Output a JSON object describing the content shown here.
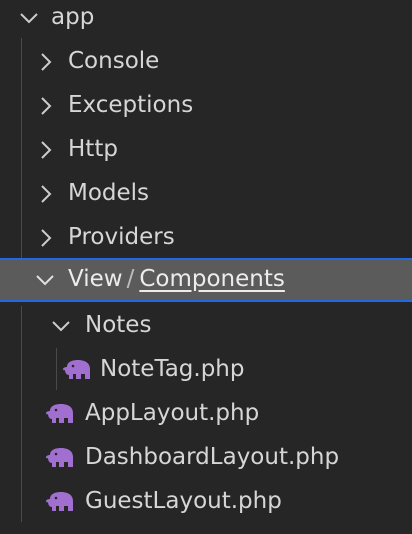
{
  "explorer": {
    "root": {
      "label": "app"
    },
    "folders": [
      {
        "label": "Console"
      },
      {
        "label": "Exceptions"
      },
      {
        "label": "Http"
      },
      {
        "label": "Models"
      },
      {
        "label": "Providers"
      }
    ],
    "selected_compact": {
      "parent": "View",
      "separator": "/",
      "child": "Components"
    },
    "subfolder": {
      "label": "Notes"
    },
    "nested_file": {
      "label": "NoteTag.php",
      "icon": "php-elephant-icon"
    },
    "files": [
      {
        "label": "AppLayout.php",
        "icon": "php-elephant-icon"
      },
      {
        "label": "DashboardLayout.php",
        "icon": "php-elephant-icon"
      },
      {
        "label": "GuestLayout.php",
        "icon": "php-elephant-icon"
      }
    ]
  },
  "colors": {
    "background": "#262626",
    "selected_background": "#5b5b5b",
    "selected_border": "#1f6ae4",
    "text": "#d6d6d6",
    "php_icon": "#a06fd0",
    "indent_guide": "#4a4a4a"
  }
}
